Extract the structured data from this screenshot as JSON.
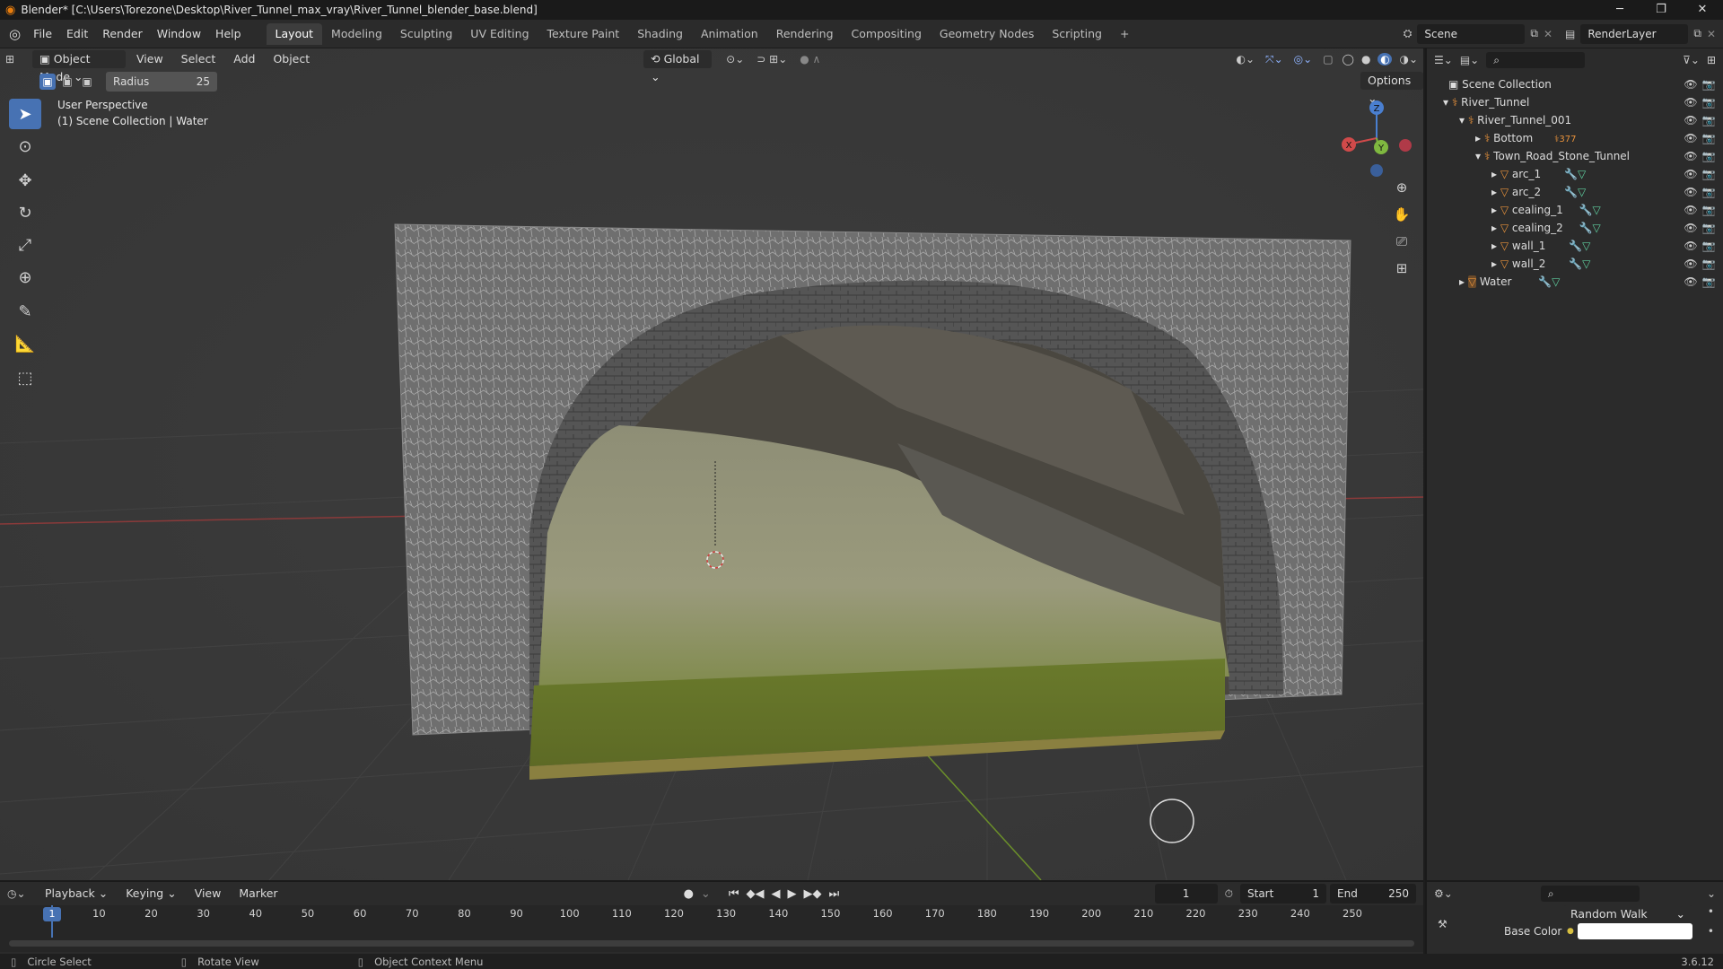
{
  "window": {
    "title": "Blender* [C:\\Users\\Torezone\\Desktop\\River_Tunnel_max_vray\\River_Tunnel_blender_base.blend]",
    "minimize": "─",
    "restore": "❐",
    "close": "✕"
  },
  "menu": [
    "File",
    "Edit",
    "Render",
    "Window",
    "Help"
  ],
  "workspaces": [
    "Layout",
    "Modeling",
    "Sculpting",
    "UV Editing",
    "Texture Paint",
    "Shading",
    "Animation",
    "Rendering",
    "Compositing",
    "Geometry Nodes",
    "Scripting"
  ],
  "workspace_add": "+",
  "scene": {
    "name": "Scene",
    "view_layer": "RenderLayer"
  },
  "viewport_header": {
    "mode": "Object Mode",
    "menus": [
      "View",
      "Select",
      "Add",
      "Object"
    ],
    "transform_orientation": "Global",
    "options": "Options"
  },
  "tool_settings": {
    "radius_label": "Radius",
    "radius_value": "25"
  },
  "viewport": {
    "perspective": "User Perspective",
    "collection_info": "(1) Scene Collection | Water",
    "gizmo": {
      "x": "X",
      "y": "Y",
      "z": "Z"
    }
  },
  "outliner": {
    "root": "Scene Collection",
    "items": [
      {
        "label": "River_Tunnel",
        "depth": 1
      },
      {
        "label": "River_Tunnel_001",
        "depth": 2
      },
      {
        "label": "Bottom",
        "depth": 3,
        "badge": "377"
      },
      {
        "label": "Town_Road_Stone_Tunnel",
        "depth": 3
      },
      {
        "label": "arc_1",
        "depth": 4
      },
      {
        "label": "arc_2",
        "depth": 4
      },
      {
        "label": "cealing_1",
        "depth": 4
      },
      {
        "label": "cealing_2",
        "depth": 4
      },
      {
        "label": "wall_1",
        "depth": 4
      },
      {
        "label": "wall_2",
        "depth": 4
      },
      {
        "label": "Water",
        "depth": 1
      }
    ]
  },
  "timeline": {
    "menus": [
      "Playback",
      "Keying",
      "View",
      "Marker"
    ],
    "current_frame": "1",
    "start_label": "Start",
    "start_value": "1",
    "end_label": "End",
    "end_value": "250",
    "ruler": [
      "1",
      "10",
      "20",
      "30",
      "40",
      "50",
      "60",
      "70",
      "80",
      "90",
      "100",
      "110",
      "120",
      "130",
      "140",
      "150",
      "160",
      "170",
      "180",
      "190",
      "200",
      "210",
      "220",
      "230",
      "240",
      "250"
    ]
  },
  "properties": {
    "subsurface_method": "Random Walk",
    "base_color_label": "Base Color"
  },
  "statusbar": {
    "left": "Circle Select",
    "middle": "Rotate View",
    "right": "Object Context Menu",
    "version": "3.6.12"
  }
}
